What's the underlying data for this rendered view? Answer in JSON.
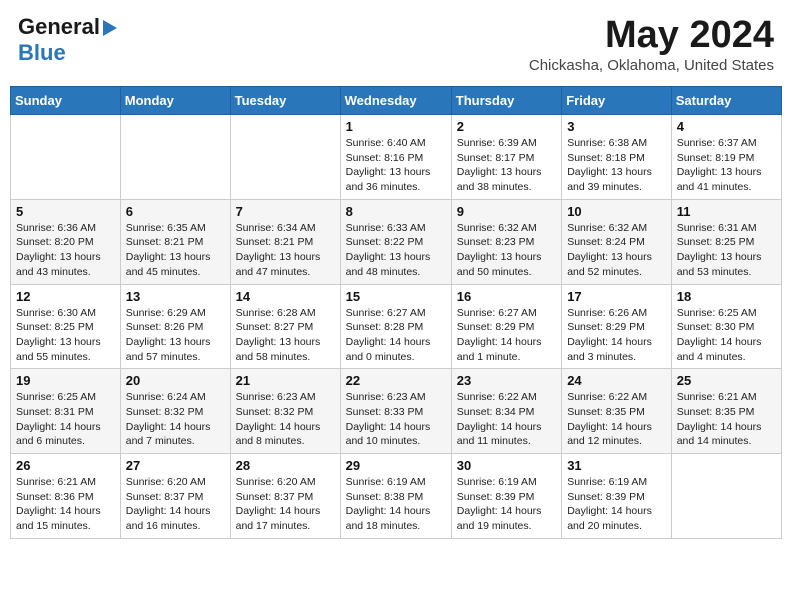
{
  "logo": {
    "line1": "General",
    "line2": "Blue"
  },
  "title": "May 2024",
  "location": "Chickasha, Oklahoma, United States",
  "days_of_week": [
    "Sunday",
    "Monday",
    "Tuesday",
    "Wednesday",
    "Thursday",
    "Friday",
    "Saturday"
  ],
  "weeks": [
    [
      {
        "day": "",
        "info": ""
      },
      {
        "day": "",
        "info": ""
      },
      {
        "day": "",
        "info": ""
      },
      {
        "day": "1",
        "info": "Sunrise: 6:40 AM\nSunset: 8:16 PM\nDaylight: 13 hours and 36 minutes."
      },
      {
        "day": "2",
        "info": "Sunrise: 6:39 AM\nSunset: 8:17 PM\nDaylight: 13 hours and 38 minutes."
      },
      {
        "day": "3",
        "info": "Sunrise: 6:38 AM\nSunset: 8:18 PM\nDaylight: 13 hours and 39 minutes."
      },
      {
        "day": "4",
        "info": "Sunrise: 6:37 AM\nSunset: 8:19 PM\nDaylight: 13 hours and 41 minutes."
      }
    ],
    [
      {
        "day": "5",
        "info": "Sunrise: 6:36 AM\nSunset: 8:20 PM\nDaylight: 13 hours and 43 minutes."
      },
      {
        "day": "6",
        "info": "Sunrise: 6:35 AM\nSunset: 8:21 PM\nDaylight: 13 hours and 45 minutes."
      },
      {
        "day": "7",
        "info": "Sunrise: 6:34 AM\nSunset: 8:21 PM\nDaylight: 13 hours and 47 minutes."
      },
      {
        "day": "8",
        "info": "Sunrise: 6:33 AM\nSunset: 8:22 PM\nDaylight: 13 hours and 48 minutes."
      },
      {
        "day": "9",
        "info": "Sunrise: 6:32 AM\nSunset: 8:23 PM\nDaylight: 13 hours and 50 minutes."
      },
      {
        "day": "10",
        "info": "Sunrise: 6:32 AM\nSunset: 8:24 PM\nDaylight: 13 hours and 52 minutes."
      },
      {
        "day": "11",
        "info": "Sunrise: 6:31 AM\nSunset: 8:25 PM\nDaylight: 13 hours and 53 minutes."
      }
    ],
    [
      {
        "day": "12",
        "info": "Sunrise: 6:30 AM\nSunset: 8:25 PM\nDaylight: 13 hours and 55 minutes."
      },
      {
        "day": "13",
        "info": "Sunrise: 6:29 AM\nSunset: 8:26 PM\nDaylight: 13 hours and 57 minutes."
      },
      {
        "day": "14",
        "info": "Sunrise: 6:28 AM\nSunset: 8:27 PM\nDaylight: 13 hours and 58 minutes."
      },
      {
        "day": "15",
        "info": "Sunrise: 6:27 AM\nSunset: 8:28 PM\nDaylight: 14 hours and 0 minutes."
      },
      {
        "day": "16",
        "info": "Sunrise: 6:27 AM\nSunset: 8:29 PM\nDaylight: 14 hours and 1 minute."
      },
      {
        "day": "17",
        "info": "Sunrise: 6:26 AM\nSunset: 8:29 PM\nDaylight: 14 hours and 3 minutes."
      },
      {
        "day": "18",
        "info": "Sunrise: 6:25 AM\nSunset: 8:30 PM\nDaylight: 14 hours and 4 minutes."
      }
    ],
    [
      {
        "day": "19",
        "info": "Sunrise: 6:25 AM\nSunset: 8:31 PM\nDaylight: 14 hours and 6 minutes."
      },
      {
        "day": "20",
        "info": "Sunrise: 6:24 AM\nSunset: 8:32 PM\nDaylight: 14 hours and 7 minutes."
      },
      {
        "day": "21",
        "info": "Sunrise: 6:23 AM\nSunset: 8:32 PM\nDaylight: 14 hours and 8 minutes."
      },
      {
        "day": "22",
        "info": "Sunrise: 6:23 AM\nSunset: 8:33 PM\nDaylight: 14 hours and 10 minutes."
      },
      {
        "day": "23",
        "info": "Sunrise: 6:22 AM\nSunset: 8:34 PM\nDaylight: 14 hours and 11 minutes."
      },
      {
        "day": "24",
        "info": "Sunrise: 6:22 AM\nSunset: 8:35 PM\nDaylight: 14 hours and 12 minutes."
      },
      {
        "day": "25",
        "info": "Sunrise: 6:21 AM\nSunset: 8:35 PM\nDaylight: 14 hours and 14 minutes."
      }
    ],
    [
      {
        "day": "26",
        "info": "Sunrise: 6:21 AM\nSunset: 8:36 PM\nDaylight: 14 hours and 15 minutes."
      },
      {
        "day": "27",
        "info": "Sunrise: 6:20 AM\nSunset: 8:37 PM\nDaylight: 14 hours and 16 minutes."
      },
      {
        "day": "28",
        "info": "Sunrise: 6:20 AM\nSunset: 8:37 PM\nDaylight: 14 hours and 17 minutes."
      },
      {
        "day": "29",
        "info": "Sunrise: 6:19 AM\nSunset: 8:38 PM\nDaylight: 14 hours and 18 minutes."
      },
      {
        "day": "30",
        "info": "Sunrise: 6:19 AM\nSunset: 8:39 PM\nDaylight: 14 hours and 19 minutes."
      },
      {
        "day": "31",
        "info": "Sunrise: 6:19 AM\nSunset: 8:39 PM\nDaylight: 14 hours and 20 minutes."
      },
      {
        "day": "",
        "info": ""
      }
    ]
  ]
}
